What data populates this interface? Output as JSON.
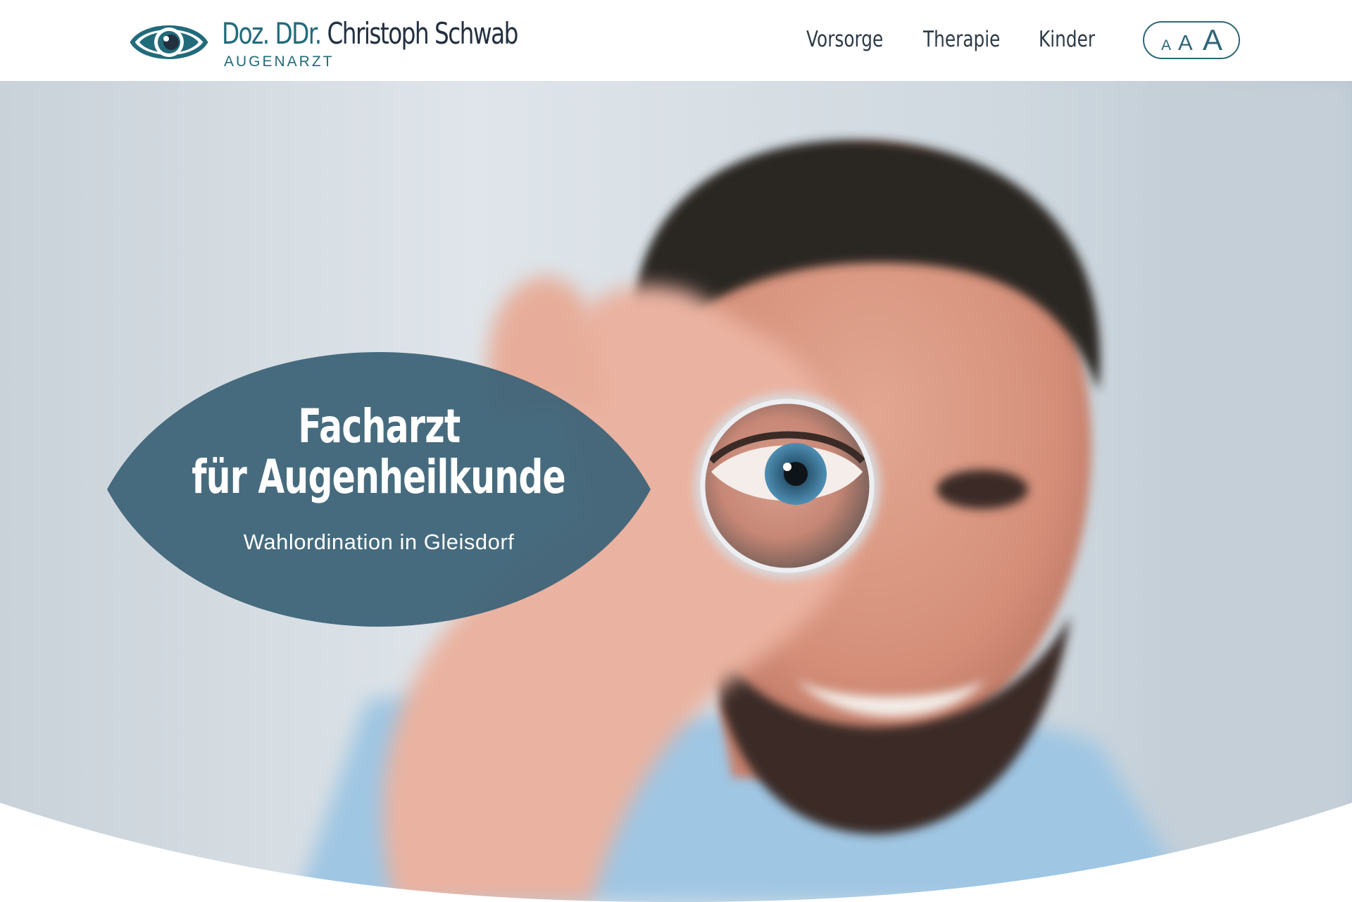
{
  "brand": {
    "title": "Doz. DDr.",
    "name": "Christoph Schwab",
    "subtitle": "AUGENARZT",
    "logo_icon": "eye-icon",
    "colors": {
      "teal": "#216b7b",
      "dark": "#223040"
    }
  },
  "nav": {
    "items": [
      {
        "label": "Vorsorge"
      },
      {
        "label": "Therapie"
      },
      {
        "label": "Kinder"
      }
    ]
  },
  "font_size_control": {
    "small": "A",
    "medium": "A",
    "large": "A"
  },
  "hero": {
    "headline_line1": "Facharzt",
    "headline_line2": "für Augenheilkunde",
    "subheadline": "Wahlordination in Gleisdorf",
    "badge_color": "#3e6478"
  }
}
